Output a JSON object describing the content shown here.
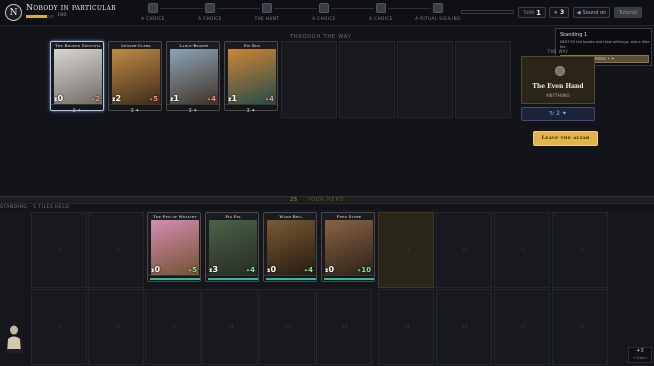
{
  "player": {
    "initial": "N",
    "name": "Nobody in particular",
    "xp": "180",
    "xp_fill": 0.75
  },
  "steps": [
    {
      "label": "A CHOICE"
    },
    {
      "label": "A CHOICE"
    },
    {
      "label": "THE HUNT"
    },
    {
      "label": "A CHOICE"
    },
    {
      "label": "A CHOICE"
    },
    {
      "label": "A RITUAL SIGILING"
    }
  ],
  "status": {
    "turn_label": "TURN",
    "turn_value": "1",
    "gold_value": "3",
    "sound_label": "Sound on",
    "dismiss_label": "Tutorial"
  },
  "tooltip": {
    "title": "Standing 1",
    "body": "NEXT Fill the bodies and raise offerings, and a little tile",
    "button": "FEED • ✦"
  },
  "altar": {
    "label": "THROUGH THE WAY",
    "cards": [
      {
        "title": "The Broken Sentinel",
        "left": "0",
        "right": "2",
        "right_color": "red",
        "badge": "3 ✦",
        "art": [
          "#d9d6cf",
          "#6d6a66"
        ]
      },
      {
        "title": "Ledger-Clerk",
        "left": "2",
        "right": "5",
        "right_color": "red",
        "badge": "3 ✦",
        "art": [
          "#c08a45",
          "#3b2a18"
        ]
      },
      {
        "title": "Ladle-Bearer",
        "left": "1",
        "right": "4",
        "right_color": "red",
        "badge": "3 ✦",
        "art": [
          "#8ca4b7",
          "#3f3125"
        ]
      },
      {
        "title": "Pie Box",
        "left": "1",
        "right": "4",
        "right_color": "red",
        "badge": "3 ✦",
        "art": [
          "#d08435",
          "#1f4b49"
        ]
      }
    ]
  },
  "way": {
    "header": "THE WAY",
    "name": "The Even Hand",
    "sub": "ANYTHING",
    "count": "↻ 2 ✦"
  },
  "leave_button": "Leave the altar",
  "divider": {
    "count": "25",
    "label": "YOUR HERD"
  },
  "hold_label": "STANDING · 5 TILES HELD",
  "hand": {
    "cards": [
      {
        "title": "The Pen of Wealthy",
        "left": "0",
        "right": "5",
        "right_color": "grn",
        "art": [
          "#d58db0",
          "#70502f"
        ]
      },
      {
        "title": "Pig Pig",
        "left": "3",
        "right": "4",
        "right_color": "grn",
        "art": [
          "#4b6148",
          "#262b23"
        ]
      },
      {
        "title": "Wash Bell",
        "left": "0",
        "right": "4",
        "right_color": "grn",
        "art": [
          "#7a5a32",
          "#231a12"
        ]
      },
      {
        "title": "Feed Store",
        "left": "0",
        "right": "10",
        "right_color": "grn",
        "art": [
          "#8a6342",
          "#2a2018"
        ]
      }
    ],
    "placeholder": "+1"
  },
  "turns": {
    "value": "3",
    "label": "+1/turn"
  },
  "colors": {
    "accent": "#e3b34c",
    "teal": "#2dbb9c",
    "panel": "#2b2519"
  }
}
